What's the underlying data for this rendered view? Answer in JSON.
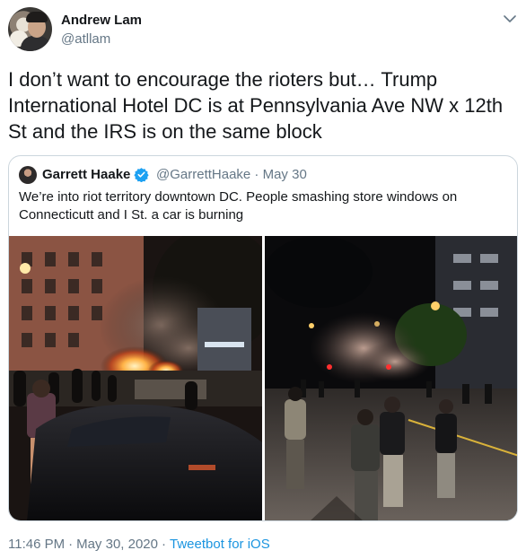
{
  "author": {
    "display_name": "Andrew Lam",
    "handle": "@atllam"
  },
  "tweet": {
    "text": "I don’t want to encourage the rioters but… Trump International Hotel DC is at Pennsylvania Ave NW x 12th St and the IRS is on the same block"
  },
  "quoted_tweet": {
    "display_name": "Garrett Haake",
    "verified": true,
    "handle_and_date": "@GarrettHaake · May 30",
    "text": "We’re into riot territory downtown DC. People smashing store windows on Connecticutt and I St. a car is burning"
  },
  "footer": {
    "time": "11:46 PM",
    "date": "May 30, 2020",
    "separator": "·",
    "source": "Tweetbot for iOS"
  },
  "colors": {
    "text": "#14171a",
    "secondary": "#657786",
    "link": "#1b95e0",
    "verified": "#1da1f2",
    "border": "#ccd6dd"
  },
  "icons": {
    "more": "chevron-down-icon",
    "verified": "verified-badge-icon"
  }
}
